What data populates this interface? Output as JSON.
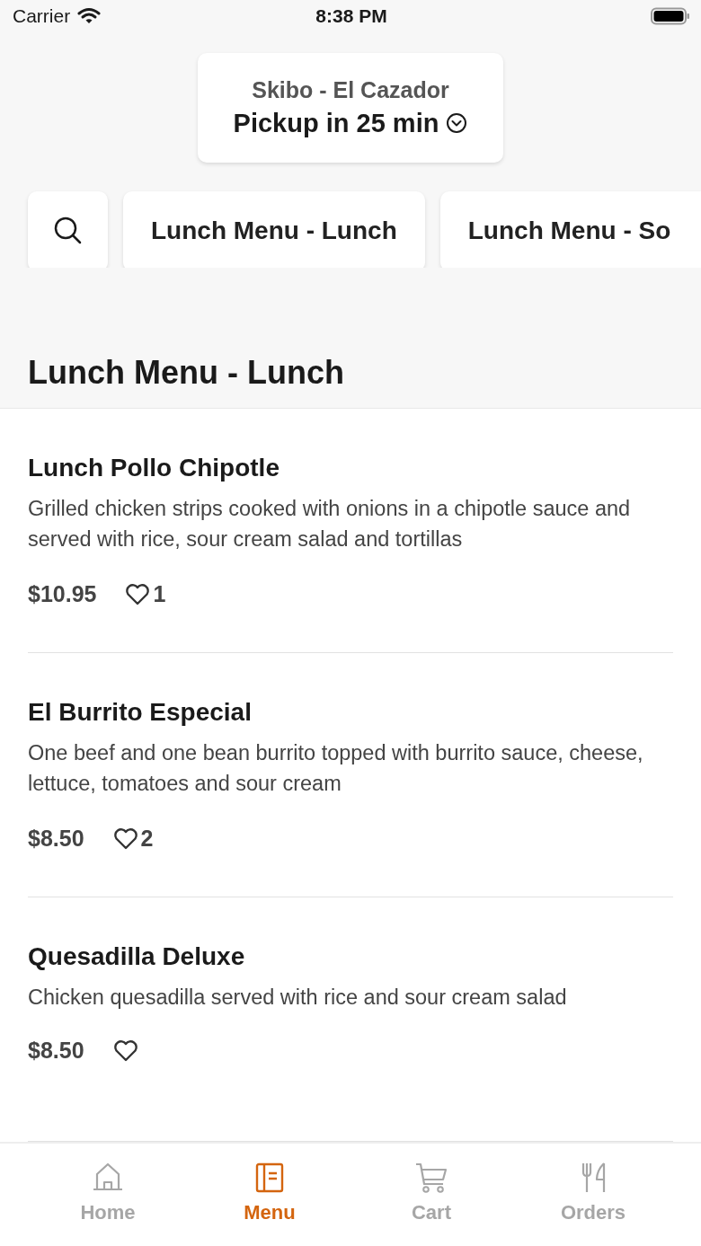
{
  "status_bar": {
    "carrier": "Carrier",
    "time": "8:38 PM"
  },
  "location": {
    "store": "Skibo - El Cazador",
    "pickup": "Pickup in 25 min"
  },
  "categories": [
    {
      "label": "Lunch Menu - Lunch"
    },
    {
      "label": "Lunch Menu - So"
    }
  ],
  "section_title": "Lunch Menu - Lunch",
  "items": [
    {
      "name": "Lunch Pollo Chipotle",
      "description": "Grilled chicken strips cooked with onions in a chipotle sauce and served with rice, sour cream salad and tortillas",
      "price": "$10.95",
      "likes": "1"
    },
    {
      "name": "El Burrito Especial",
      "description": "One beef and one bean burrito topped with burrito sauce, cheese, lettuce, tomatoes and sour cream",
      "price": "$8.50",
      "likes": "2"
    },
    {
      "name": "Quesadilla Deluxe",
      "description": "Chicken quesadilla served with rice and sour cream salad",
      "price": "$8.50"
    }
  ],
  "tab_bar": [
    {
      "kind": "home",
      "label": "Home",
      "selected": false
    },
    {
      "kind": "menu",
      "label": "Menu",
      "selected": true
    },
    {
      "kind": "cart",
      "label": "Cart",
      "selected": false
    },
    {
      "kind": "orders",
      "label": "Orders",
      "selected": false
    }
  ]
}
